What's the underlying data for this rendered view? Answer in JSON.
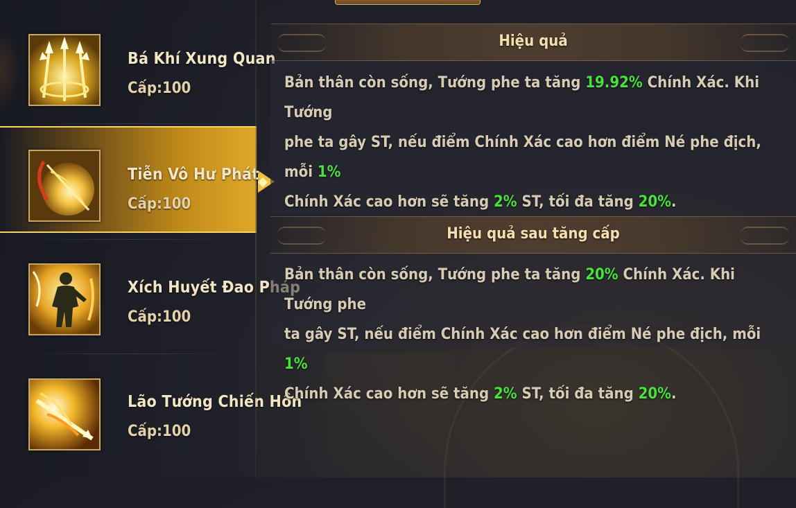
{
  "skills": [
    {
      "name": "Bá Khí Xung Quan",
      "level": "Cấp:100",
      "icon": "golden-tridents-icon",
      "active": false
    },
    {
      "name": "Tiễn Vô Hư Phát",
      "level": "Cấp:100",
      "icon": "flaming-arrow-orb-icon",
      "active": true
    },
    {
      "name": "Xích Huyết Đao Pháp",
      "level": "Cấp:100",
      "icon": "warrior-silhouette-fire-icon",
      "active": false
    },
    {
      "name": "Lão Tướng Chiến Hồn",
      "level": "Cấp:100",
      "icon": "fire-spear-burst-icon",
      "active": false
    }
  ],
  "effect": {
    "title": "Hiệu quả",
    "line1_a": "Bản thân còn sống, Tướng phe ta tăng ",
    "line1_v": "19.92%",
    "line1_b": " Chính Xác. Khi Tướng",
    "line2_a": "phe ta gây ST, nếu điểm Chính Xác cao hơn điểm Né phe địch, mỗi ",
    "line2_v": "1%",
    "line3_a": "Chính Xác cao hơn sẽ tăng ",
    "line3_v1": "2%",
    "line3_b": " ST, tối đa tăng ",
    "line3_v2": "20%",
    "line3_c": "."
  },
  "upgrade_effect": {
    "title": "Hiệu quả sau tăng cấp",
    "line1_a": "Bản thân còn sống, Tướng phe ta tăng ",
    "line1_v": "20%",
    "line1_b": " Chính Xác. Khi Tướng phe",
    "line2_a": "ta gây ST, nếu điểm Chính Xác cao hơn điểm Né phe địch, mỗi ",
    "line2_v": "1%",
    "line3_a": "Chính Xác cao hơn sẽ tăng ",
    "line3_v1": "2%",
    "line3_b": " ST, tối đa tăng ",
    "line3_v2": "20%",
    "line3_c": "."
  },
  "colors": {
    "highlight": "#47e23a",
    "text": "#d7cbb4",
    "title": "#f5dfae",
    "active_gold": "#e0a829"
  }
}
